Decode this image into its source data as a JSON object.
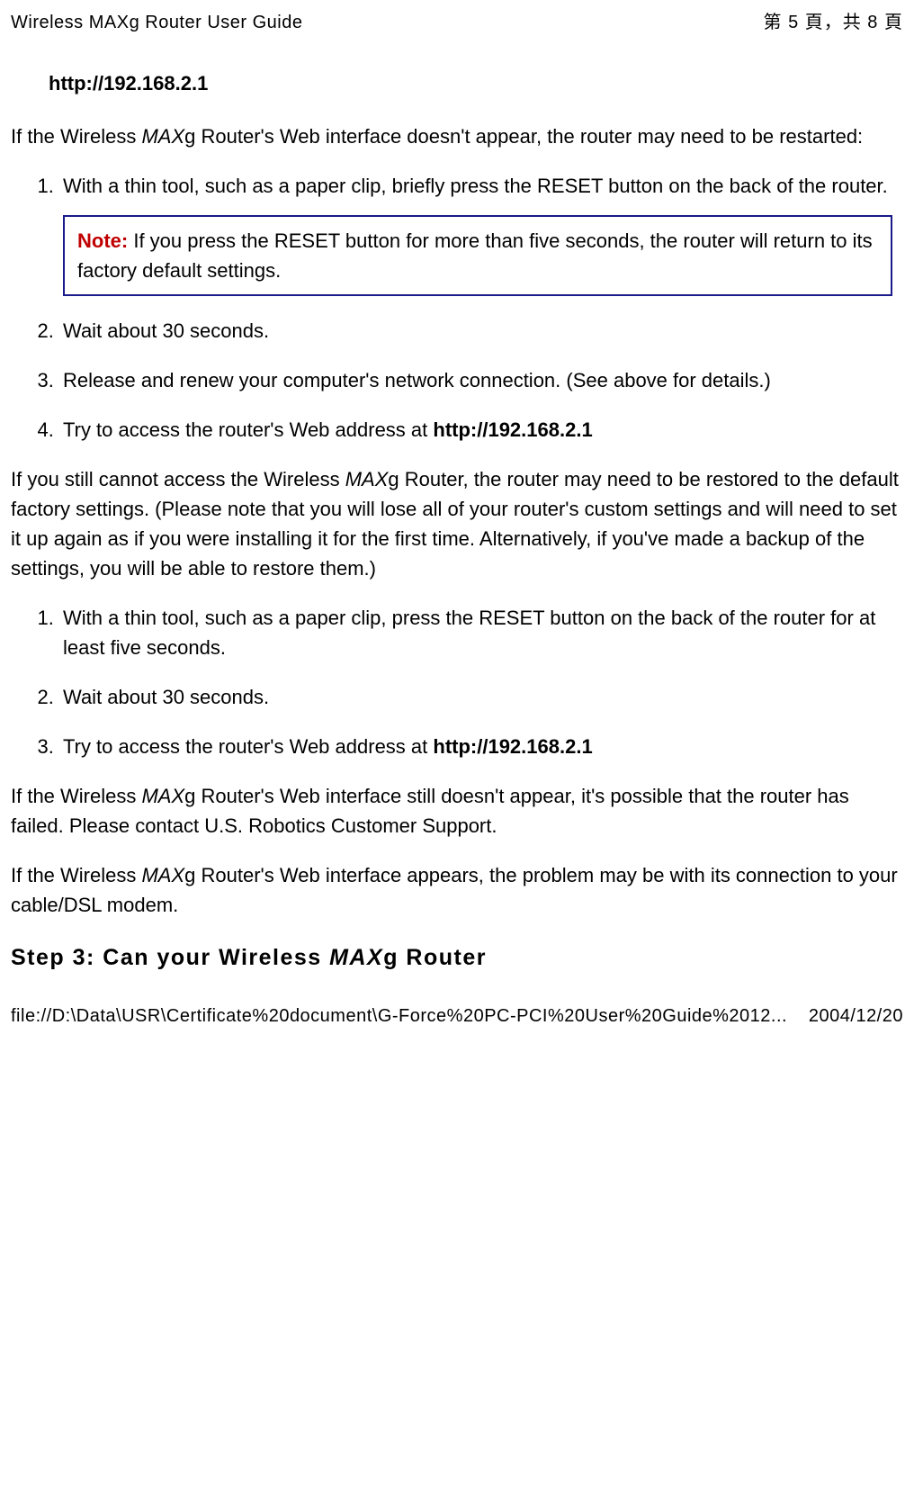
{
  "header": {
    "left": "Wireless MAXg Router User Guide",
    "right": "第 5 頁，共 8 頁"
  },
  "url_line": "http://192.168.2.1",
  "para1_a": "If the Wireless ",
  "para1_b": "MAX",
  "para1_c": "g Router's Web interface doesn't appear, the router may need to be restarted:",
  "list1": {
    "item1": "With a thin tool, such as a paper clip, briefly press the RESET button on the back of the router.",
    "note_label": "Note:",
    "note_text": " If you press the RESET button for more than five seconds, the router will return to its factory default settings.",
    "item2": "Wait about 30 seconds.",
    "item3": "Release and renew your computer's network connection. (See above for details.)",
    "item4_a": "Try to access the router's Web address at ",
    "item4_b": "http://192.168.2.1"
  },
  "para2_a": "If you still cannot access the Wireless ",
  "para2_b": "MAX",
  "para2_c": "g Router, the router may need to be restored to the default factory settings. (Please note that you will lose all of your router's custom settings and will need to set it up again as if you were installing it for the first time. Alternatively, if you've made a backup of the settings, you will be able to restore them.)",
  "list2": {
    "item1": "With a thin tool, such as a paper clip, press the RESET button on the back of the router for at least five seconds.",
    "item2": "Wait about 30 seconds.",
    "item3_a": "Try to access the router's Web address at ",
    "item3_b": "http://192.168.2.1"
  },
  "para3_a": "If the Wireless ",
  "para3_b": "MAX",
  "para3_c": "g Router's Web interface still doesn't appear, it's possible that the router has failed. Please contact U.S. Robotics Customer Support.",
  "para4_a": "If the Wireless ",
  "para4_b": "MAX",
  "para4_c": "g Router's Web interface appears, the problem may be with its connection to your cable/DSL modem.",
  "step_heading_a": "Step 3: Can your Wireless ",
  "step_heading_b": "MAX",
  "step_heading_c": "g Router",
  "footer": {
    "left": "file://D:\\Data\\USR\\Certificate%20document\\G-Force%20PC-PCI%20User%20Guide%2012...",
    "right": "2004/12/20"
  }
}
